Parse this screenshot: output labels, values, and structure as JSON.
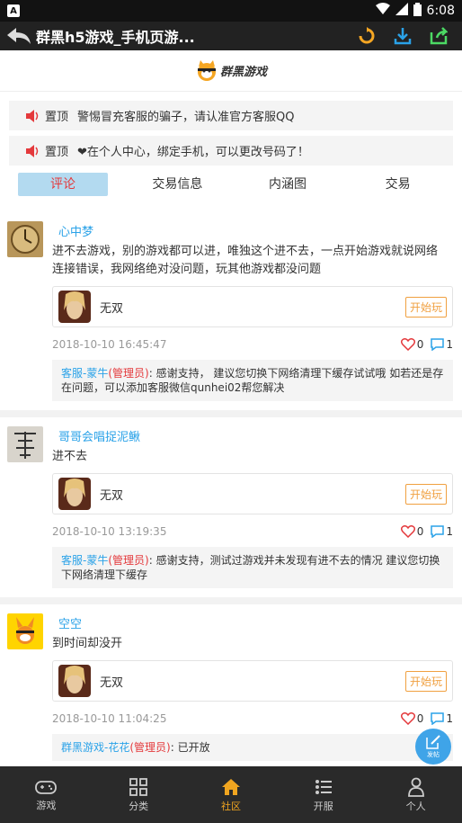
{
  "status_bar": {
    "app_badge": "A",
    "time": "6:08"
  },
  "title_bar": {
    "title": "群黑h5游戏_手机页游..."
  },
  "logo": {
    "text": "群黑游戏"
  },
  "notices": [
    {
      "tag": "置顶",
      "text": "警惕冒充客服的骗子，请认准官方客服QQ"
    },
    {
      "tag": "置顶",
      "text": "❤在个人中心，绑定手机，可以更改号码了！"
    }
  ],
  "tabs": [
    {
      "label": "评论"
    },
    {
      "label": "交易信息"
    },
    {
      "label": "内涵图"
    },
    {
      "label": "交易"
    }
  ],
  "posts": [
    {
      "user": "心中梦",
      "content": "进不去游戏，别的游戏都可以进，唯独这个进不去，一点开始游戏就说网络连接错误，我网络绝对没问题，玩其他游戏都没问题",
      "game_name": "无双",
      "play_label": "开始玩",
      "time": "2018-10-10 16:45:47",
      "likes": "0",
      "comments": "1",
      "reply_name": "客服-蒙牛",
      "reply_role": "(管理员)",
      "reply_text": ": 感谢支持， 建议您切换下网络清理下缓存试试哦 如若还是存在问题，可以添加客服微信qunhei02帮您解决"
    },
    {
      "user": "哥哥会唱捉泥鳅",
      "content": "进不去",
      "game_name": "无双",
      "play_label": "开始玩",
      "time": "2018-10-10 13:19:35",
      "likes": "0",
      "comments": "1",
      "reply_name": "客服-蒙牛",
      "reply_role": "(管理员)",
      "reply_text": ": 感谢支持，测试过游戏并未发现有进不去的情况 建议您切换下网络清理下缓存"
    },
    {
      "user": "空空",
      "content": "到时间却没开",
      "game_name": "无双",
      "play_label": "开始玩",
      "time": "2018-10-10 11:04:25",
      "likes": "0",
      "comments": "1",
      "reply_name": "群黑游戏-花花",
      "reply_role": "(管理员)",
      "reply_text": ": 已开放"
    }
  ],
  "fab": {
    "label": "发帖"
  },
  "bottom_nav": [
    {
      "label": "游戏"
    },
    {
      "label": "分类"
    },
    {
      "label": "社区"
    },
    {
      "label": "开服"
    },
    {
      "label": "个人"
    }
  ],
  "colors": {
    "accent_blue": "#2aa2e8",
    "active_red": "#e4393c",
    "nav_active": "#f0a520",
    "tab_bg": "#b3daf0"
  }
}
